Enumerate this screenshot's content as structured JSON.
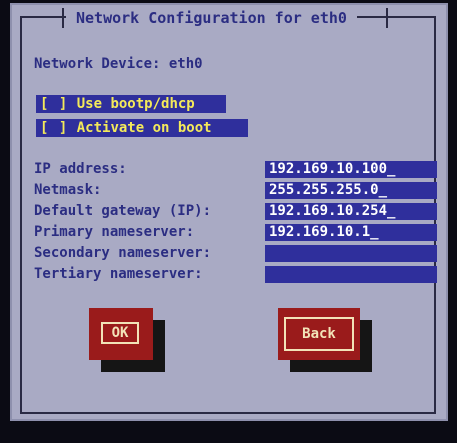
{
  "dialog": {
    "title": "Network Configuration for eth0",
    "device_label": "Network Device: eth0"
  },
  "options": [
    {
      "box": "[ ]",
      "label": "Use bootp/dhcp",
      "checked": false
    },
    {
      "box": "[ ]",
      "label": "Activate on boot",
      "checked": false
    }
  ],
  "fields": [
    {
      "label": "IP address:",
      "value": "192.169.10.100",
      "cursor": "_"
    },
    {
      "label": "Netmask:",
      "value": "255.255.255.0",
      "cursor": "_"
    },
    {
      "label": "Default gateway (IP):",
      "value": "192.169.10.254",
      "cursor": "_"
    },
    {
      "label": "Primary nameserver:",
      "value": "192.169.10.1",
      "cursor": "_"
    },
    {
      "label": "Secondary nameserver:",
      "value": "",
      "cursor": ""
    },
    {
      "label": "Tertiary nameserver:",
      "value": "",
      "cursor": ""
    }
  ],
  "buttons": {
    "ok_label": "OK",
    "back_label": "Back"
  },
  "colors": {
    "dialog_bg": "#a9aac4",
    "label_text": "#2b2d82",
    "field_bg": "#2f2f9c",
    "checkbox_text": "#f4ea5a",
    "button_bg": "#9a1b1b",
    "button_text": "#f2e3b8"
  }
}
